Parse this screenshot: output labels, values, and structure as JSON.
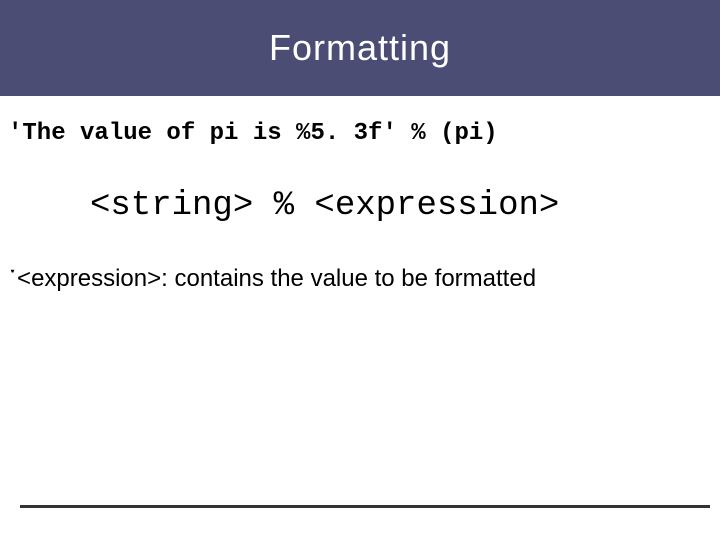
{
  "title": "Formatting",
  "code_example": "'The value of pi is %5. 3f' % (pi)",
  "syntax": "<string> % <expression>",
  "bullet_glyph": "་",
  "description_term": "<expression>:",
  "description_body": " contains the value to be formatted"
}
